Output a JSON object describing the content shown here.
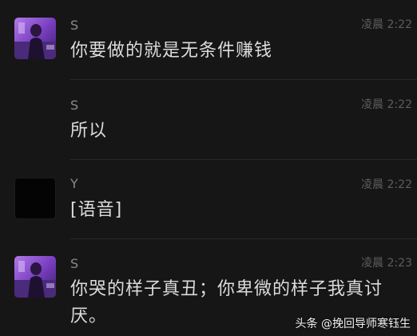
{
  "messages": [
    {
      "sender": "S",
      "time": "凌晨 2:22",
      "text": "你要做的就是无条件赚钱",
      "avatar": "photo-avatar"
    },
    {
      "sender": "S",
      "time": "凌晨 2:22",
      "text": "所以",
      "avatar": ""
    },
    {
      "sender": "Y",
      "time": "凌晨 2:22",
      "text": "[语音]",
      "avatar": "black-avatar"
    },
    {
      "sender": "S",
      "time": "凌晨 2:23",
      "text_line1": "你哭的样子真丑；你卑微的样子我真讨",
      "text_line2": "厌。",
      "avatar": "photo-avatar"
    }
  ],
  "watermark": "头条 @挽回导师寒钰生",
  "colors": {
    "background": "#161616",
    "message_text": "#dcdcdc",
    "sender_text": "#8a8a8a",
    "time_text": "#5d5d5d",
    "avatar_purple": "#7a3fc0"
  }
}
